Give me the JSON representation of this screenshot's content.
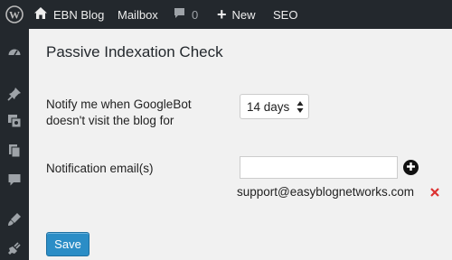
{
  "admin_bar": {
    "site_name": "EBN Blog",
    "mailbox_label": "Mailbox",
    "comments_count": "0",
    "new_label": "New",
    "seo_label": "SEO",
    "icons": [
      "wordpress-logo-icon",
      "home-icon",
      "comment-bubble-icon",
      "plus-icon"
    ]
  },
  "sidebar": {
    "icons": [
      "dashboard-icon",
      "pin-icon",
      "media-icon",
      "pages-icon",
      "comments-icon",
      "appearance-icon",
      "plugins-icon"
    ]
  },
  "page": {
    "title": "Passive Indexation Check"
  },
  "form": {
    "notify_label": "Notify me when GoogleBot doesn't visit the blog for",
    "days_selected": "14 days",
    "email_label": "Notification email(s)",
    "email_input_value": "",
    "emails": [
      "support@easyblognetworks.com"
    ],
    "save_label": "Save"
  },
  "colors": {
    "admin_bar_bg": "#23282d",
    "content_bg": "#f1f1f1",
    "primary_button": "#2b8dc6",
    "remove_icon": "#dc3232"
  }
}
